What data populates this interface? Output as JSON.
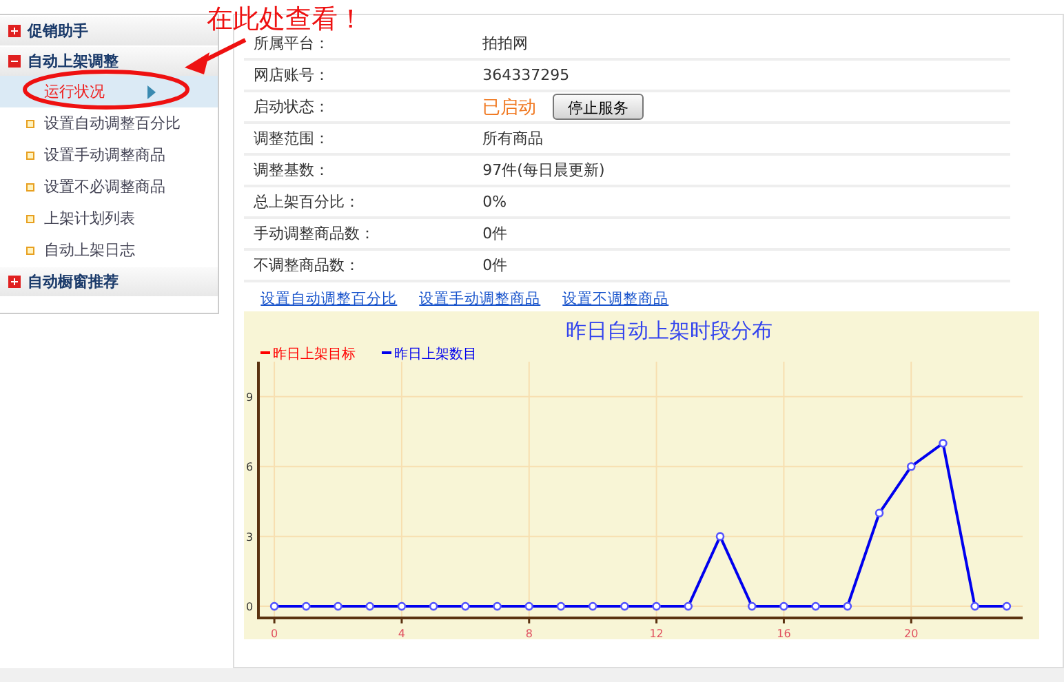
{
  "annotation": {
    "text": "在此处查看！"
  },
  "sidebar": {
    "sections": [
      {
        "title": "促销助手",
        "expanded": false
      },
      {
        "title": "自动上架调整",
        "expanded": true,
        "items": [
          {
            "label": "运行状况",
            "selected": true
          },
          {
            "label": "设置自动调整百分比",
            "selected": false
          },
          {
            "label": "设置手动调整商品",
            "selected": false
          },
          {
            "label": "设置不必调整商品",
            "selected": false
          },
          {
            "label": "上架计划列表",
            "selected": false
          },
          {
            "label": "自动上架日志",
            "selected": false
          }
        ]
      },
      {
        "title": "自动橱窗推荐",
        "expanded": false
      }
    ]
  },
  "info": {
    "rows": [
      {
        "kind": "text",
        "label": "所属平台：",
        "value": "拍拍网"
      },
      {
        "kind": "text",
        "label": "网店账号：",
        "value": "364337295"
      },
      {
        "kind": "status",
        "label": "启动状态：",
        "value": "已启动",
        "button": "停止服务"
      },
      {
        "kind": "text",
        "label": "调整范围：",
        "value": "所有商品"
      },
      {
        "kind": "text",
        "label": "调整基数：",
        "value": "97件(每日晨更新)"
      },
      {
        "kind": "text",
        "label": "总上架百分比：",
        "value": "0%"
      },
      {
        "kind": "text",
        "label": "手动调整商品数：",
        "value": "0件"
      },
      {
        "kind": "text",
        "label": "不调整商品数：",
        "value": "0件"
      }
    ],
    "links": [
      "设置自动调整百分比",
      "设置手动调整商品",
      "设置不调整商品"
    ]
  },
  "chart_data": {
    "type": "line",
    "title": "昨日自动上架时段分布",
    "x": [
      0,
      1,
      2,
      3,
      4,
      5,
      6,
      7,
      8,
      9,
      10,
      11,
      12,
      13,
      14,
      15,
      16,
      17,
      18,
      19,
      20,
      21,
      22,
      23
    ],
    "series": [
      {
        "name": "昨日上架目标",
        "color": "#ff0000",
        "values": [
          null,
          null,
          null,
          null,
          null,
          null,
          null,
          null,
          null,
          null,
          null,
          null,
          null,
          null,
          null,
          null,
          null,
          null,
          null,
          null,
          null,
          null,
          null,
          null
        ]
      },
      {
        "name": "昨日上架数目",
        "color": "#0000ee",
        "marker": "o",
        "values": [
          0,
          0,
          0,
          0,
          0,
          0,
          0,
          0,
          0,
          0,
          0,
          0,
          0,
          0,
          3,
          0,
          0,
          0,
          0,
          4,
          6,
          7,
          0,
          0
        ]
      }
    ],
    "xlim": [
      -0.5,
      23.5
    ],
    "ylim": [
      -0.5,
      10.5
    ],
    "xticks": [
      0,
      4,
      8,
      12,
      16,
      20
    ],
    "yticks": [
      0,
      3,
      6,
      9
    ],
    "grid": true
  }
}
